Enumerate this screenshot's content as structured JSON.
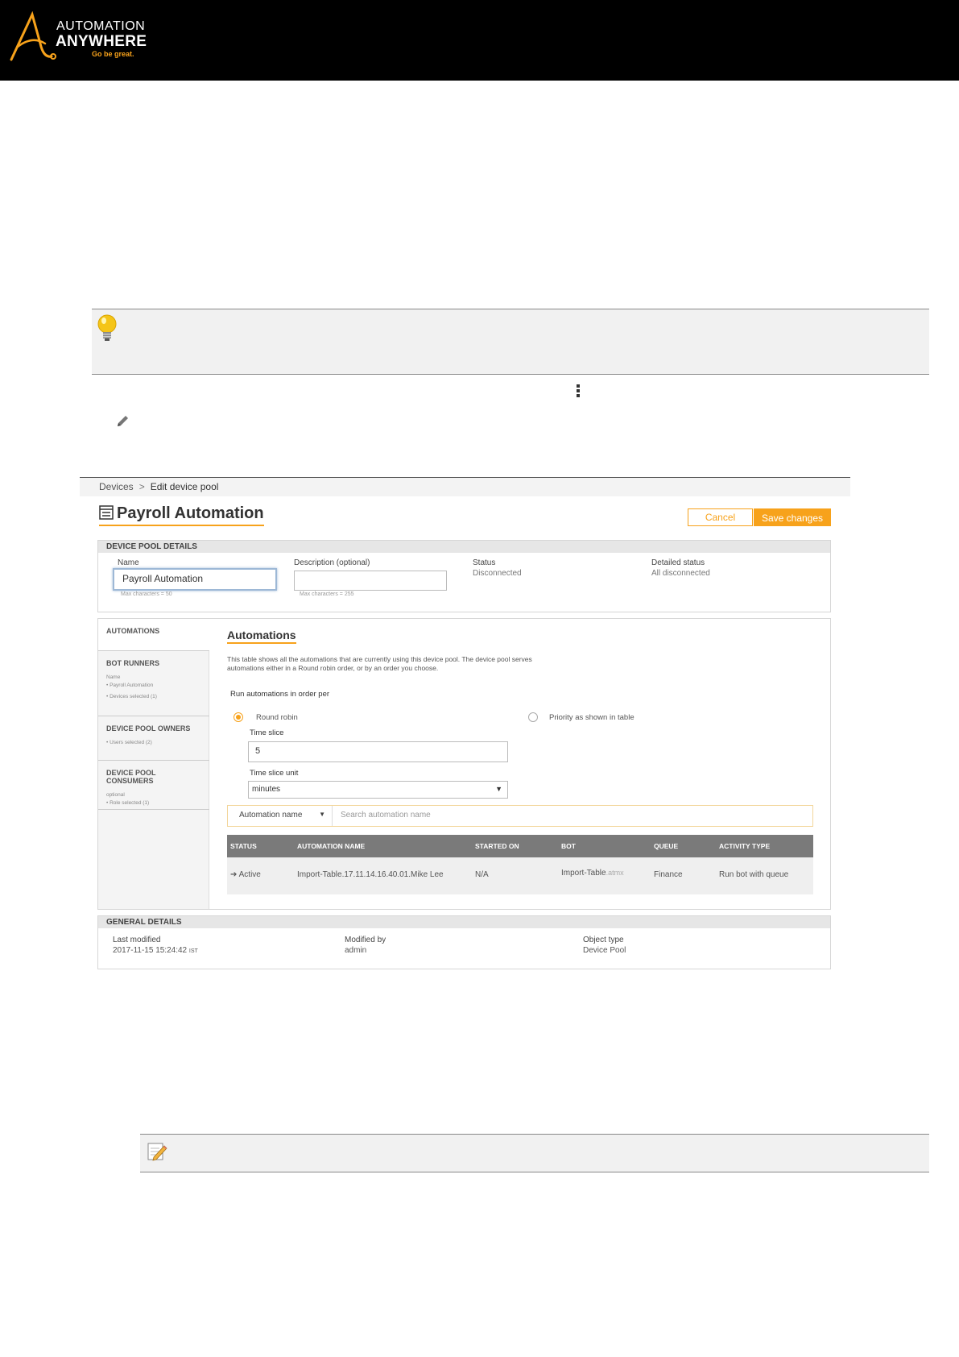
{
  "brand": {
    "line1": "AUTOMATION",
    "line2": "ANYWHERE",
    "tagline": "Go be great."
  },
  "breadcrumb": {
    "parent": "Devices",
    "separator": ">",
    "current": "Edit device pool"
  },
  "pool": {
    "title": "Payroll Automation",
    "cancel_label": "Cancel",
    "save_label": "Save changes"
  },
  "details": {
    "heading": "DEVICE POOL DETAILS",
    "name_label": "Name",
    "name_value": "Payroll Automation",
    "name_hint": "Max characters = 50",
    "desc_label": "Description (optional)",
    "desc_hint": "Max characters = 255",
    "status_label": "Status",
    "status_value": "Disconnected",
    "detailed_label": "Detailed status",
    "detailed_value": "All disconnected"
  },
  "sidebar": {
    "automations": "AUTOMATIONS",
    "bot_runners": "BOT RUNNERS",
    "bot_runners_sub1": "Name",
    "bot_runners_sub2": "• Payroll Automation",
    "bot_runners_sub3": "• Devices selected (1)",
    "owners": "DEVICE POOL OWNERS",
    "owners_sub": "• Users selected (2)",
    "consumers": "DEVICE POOL CONSUMERS",
    "consumers_sub1": "optional",
    "consumers_sub2": "• Role selected (1)"
  },
  "automations": {
    "title": "Automations",
    "description": "This table shows all the automations that are currently using this device pool. The device pool serves automations either in a Round robin order, or by an order you choose.",
    "run_label": "Run automations in order per",
    "option_round_robin": "Round robin",
    "option_priority": "Priority as shown in table",
    "time_slice_label": "Time slice",
    "time_slice_value": "5",
    "time_unit_label": "Time slice unit",
    "time_unit_value": "minutes",
    "search_filter": "Automation name",
    "search_placeholder": "Search automation name"
  },
  "table": {
    "headers": [
      "STATUS",
      "AUTOMATION NAME",
      "STARTED ON",
      "BOT",
      "QUEUE",
      "ACTIVITY TYPE"
    ],
    "row": {
      "status": "Active",
      "name": "Import-Table.17.11.14.16.40.01.Mike Lee",
      "started": "N/A",
      "bot": "Import-Table",
      "bot_ext": ".atmx",
      "queue": "Finance",
      "activity": "Run bot with queue"
    }
  },
  "general": {
    "heading": "GENERAL DETAILS",
    "modified_label": "Last modified",
    "modified_value": "2017-11-15 15:24:42",
    "modified_tz": "IST",
    "by_label": "Modified by",
    "by_value": "admin",
    "type_label": "Object type",
    "type_value": "Device Pool"
  },
  "colors": {
    "accent": "#f7a21b",
    "header_bg": "#000000"
  }
}
